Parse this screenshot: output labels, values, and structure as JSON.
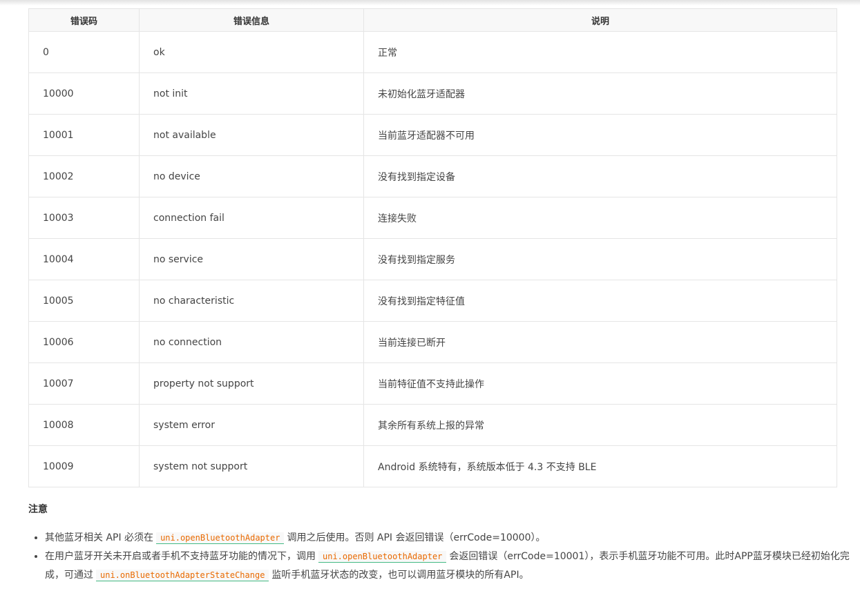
{
  "table": {
    "headers": [
      "错误码",
      "错误信息",
      "说明"
    ],
    "rows": [
      [
        "0",
        "ok",
        "正常"
      ],
      [
        "10000",
        "not init",
        "未初始化蓝牙适配器"
      ],
      [
        "10001",
        "not available",
        "当前蓝牙适配器不可用"
      ],
      [
        "10002",
        "no device",
        "没有找到指定设备"
      ],
      [
        "10003",
        "connection fail",
        "连接失败"
      ],
      [
        "10004",
        "no service",
        "没有找到指定服务"
      ],
      [
        "10005",
        "no characteristic",
        "没有找到指定特征值"
      ],
      [
        "10006",
        "no connection",
        "当前连接已断开"
      ],
      [
        "10007",
        "property not support",
        "当前特征值不支持此操作"
      ],
      [
        "10008",
        "system error",
        "其余所有系统上报的异常"
      ],
      [
        "10009",
        "system not support",
        "Android 系统特有，系统版本低于 4.3 不支持 BLE"
      ]
    ]
  },
  "notes": {
    "title": "注意",
    "item1": {
      "before": "其他蓝牙相关 API 必须在",
      "code": "uni.openBluetoothAdapter",
      "after": "调用之后使用。否则 API 会返回错误（errCode=10000）。"
    },
    "item2": {
      "before": "在用户蓝牙开关未开启或者手机不支持蓝牙功能的情况下，调用",
      "code": "uni.openBluetoothAdapter",
      "middle": "会返回错误（errCode=10001），表示手机蓝牙功能不可用。此时APP蓝牙模块已经初始化完成，可通过",
      "code2": "uni.onBluetoothAdapterStateChange",
      "after": "监听手机蓝牙状态的改变，也可以调用蓝牙模块的所有API。"
    }
  }
}
